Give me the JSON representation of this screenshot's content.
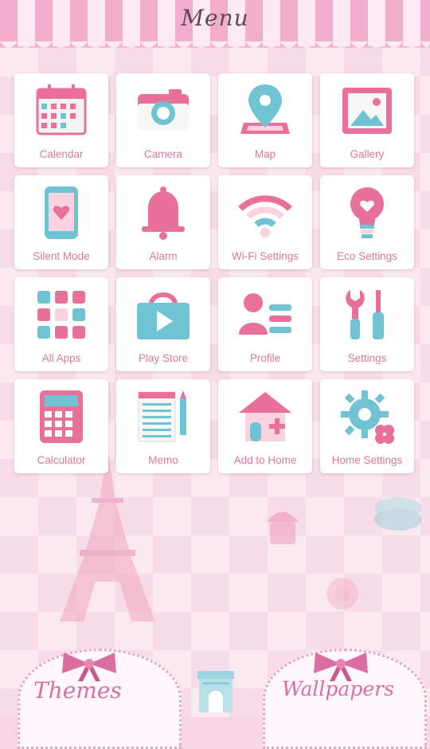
{
  "header": {
    "title": "Menu"
  },
  "apps": [
    {
      "label": "Calendar",
      "icon": "calendar-icon"
    },
    {
      "label": "Camera",
      "icon": "camera-icon"
    },
    {
      "label": "Map",
      "icon": "map-pin-icon"
    },
    {
      "label": "Gallery",
      "icon": "gallery-icon"
    },
    {
      "label": "Silent Mode",
      "icon": "phone-heart-icon"
    },
    {
      "label": "Alarm",
      "icon": "bell-icon"
    },
    {
      "label": "Wi-Fi Settings",
      "icon": "wifi-icon"
    },
    {
      "label": "Eco Settings",
      "icon": "lightbulb-heart-icon"
    },
    {
      "label": "All Apps",
      "icon": "apps-grid-icon"
    },
    {
      "label": "Play Store",
      "icon": "play-bag-icon"
    },
    {
      "label": "Profile",
      "icon": "profile-card-icon"
    },
    {
      "label": "Settings",
      "icon": "tools-icon"
    },
    {
      "label": "Calculator",
      "icon": "calculator-icon"
    },
    {
      "label": "Memo",
      "icon": "memo-pad-icon"
    },
    {
      "label": "Add to Home",
      "icon": "house-plus-icon"
    },
    {
      "label": "Home Settings",
      "icon": "gear-icon"
    }
  ],
  "footer": {
    "themes_label": "Themes",
    "wallpapers_label": "Wallpapers"
  },
  "colors": {
    "pink": "#e8709a",
    "blue": "#6fc3d3",
    "label": "#d67a9c"
  }
}
